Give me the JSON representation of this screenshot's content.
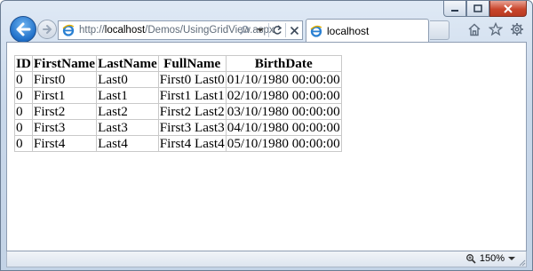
{
  "browser": {
    "url_prefix": "http://",
    "url_host": "localhost",
    "url_path": "/Demos/UsingGridView.aspx",
    "tab_title": "localhost",
    "zoom": "150%"
  },
  "grid": {
    "columns": [
      "ID",
      "FirstName",
      "LastName",
      "FullName",
      "BirthDate"
    ],
    "rows": [
      [
        "0",
        "First0",
        "Last0",
        "First0 Last0",
        "01/10/1980 00:00:00"
      ],
      [
        "0",
        "First1",
        "Last1",
        "First1 Last1",
        "02/10/1980 00:00:00"
      ],
      [
        "0",
        "First2",
        "Last2",
        "First2 Last2",
        "03/10/1980 00:00:00"
      ],
      [
        "0",
        "First3",
        "Last3",
        "First3 Last3",
        "04/10/1980 00:00:00"
      ],
      [
        "0",
        "First4",
        "Last4",
        "First4 Last4",
        "05/10/1980 00:00:00"
      ]
    ]
  },
  "icons": {
    "back": "back-arrow-icon",
    "forward": "forward-arrow-icon",
    "search": "search-icon",
    "dropdown": "chevron-down-icon",
    "refresh": "refresh-icon",
    "stop": "stop-icon",
    "home": "home-icon",
    "favorites": "star-icon",
    "tools": "gear-icon",
    "zoom": "zoom-icon"
  },
  "colors": {
    "accent": "#1f6fc8",
    "close_button": "#c9462c",
    "grid_border": "#c9c9c9"
  }
}
